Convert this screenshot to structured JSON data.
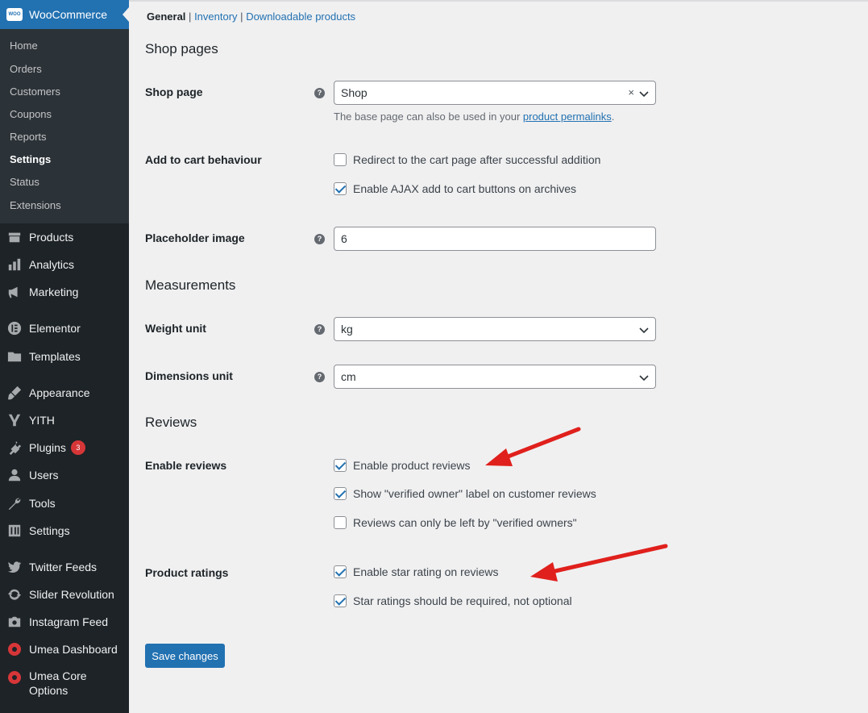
{
  "sidebar": {
    "header": {
      "logo_text": "WOO",
      "label": "WooCommerce"
    },
    "submenu": [
      "Home",
      "Orders",
      "Customers",
      "Coupons",
      "Reports",
      "Settings",
      "Status",
      "Extensions"
    ],
    "active_submenu": "Settings",
    "menu": [
      {
        "label": "Products",
        "icon": "products-icon"
      },
      {
        "label": "Analytics",
        "icon": "analytics-icon"
      },
      {
        "label": "Marketing",
        "icon": "marketing-icon"
      },
      {
        "label": "Elementor",
        "icon": "elementor-icon"
      },
      {
        "label": "Templates",
        "icon": "folder-icon"
      },
      {
        "label": "Appearance",
        "icon": "brush-icon"
      },
      {
        "label": "YITH",
        "icon": "yith-icon"
      },
      {
        "label": "Plugins",
        "icon": "plugin-icon",
        "badge": "3"
      },
      {
        "label": "Users",
        "icon": "user-icon"
      },
      {
        "label": "Tools",
        "icon": "wrench-icon"
      },
      {
        "label": "Settings",
        "icon": "settings-icon"
      },
      {
        "label": "Twitter Feeds",
        "icon": "twitter-icon"
      },
      {
        "label": "Slider Revolution",
        "icon": "refresh-icon"
      },
      {
        "label": "Instagram Feed",
        "icon": "camera-icon"
      },
      {
        "label": "Umea Dashboard",
        "icon": "umea-icon"
      },
      {
        "label": "Umea Core Options",
        "icon": "umea-icon"
      }
    ]
  },
  "tabs": {
    "current": "General",
    "sep1": "|",
    "inventory": "Inventory",
    "sep2": "|",
    "downloadable": "Downloadable products"
  },
  "sections": {
    "shop_pages": "Shop pages",
    "measurements": "Measurements",
    "reviews": "Reviews"
  },
  "fields": {
    "shop_page": {
      "label": "Shop page",
      "value": "Shop",
      "desc_prefix": "The base page can also be used in your ",
      "desc_link": "product permalinks",
      "desc_suffix": "."
    },
    "add_to_cart": {
      "label": "Add to cart behaviour",
      "options": [
        {
          "label": "Redirect to the cart page after successful addition",
          "checked": false
        },
        {
          "label": "Enable AJAX add to cart buttons on archives",
          "checked": true
        }
      ]
    },
    "placeholder_image": {
      "label": "Placeholder image",
      "value": "6"
    },
    "weight_unit": {
      "label": "Weight unit",
      "value": "kg"
    },
    "dimensions_unit": {
      "label": "Dimensions unit",
      "value": "cm"
    },
    "enable_reviews": {
      "label": "Enable reviews",
      "options": [
        {
          "label": "Enable product reviews",
          "checked": true
        },
        {
          "label": "Show \"verified owner\" label on customer reviews",
          "checked": true
        },
        {
          "label": "Reviews can only be left by \"verified owners\"",
          "checked": false
        }
      ]
    },
    "product_ratings": {
      "label": "Product ratings",
      "options": [
        {
          "label": "Enable star rating on reviews",
          "checked": true
        },
        {
          "label": "Star ratings should be required, not optional",
          "checked": true
        }
      ]
    }
  },
  "help_glyph": "?",
  "clear_glyph": "×",
  "save_label": "Save changes",
  "colors": {
    "sidebar": "#1d2327",
    "accent": "#2271b1",
    "annotation": "#e0201c"
  }
}
